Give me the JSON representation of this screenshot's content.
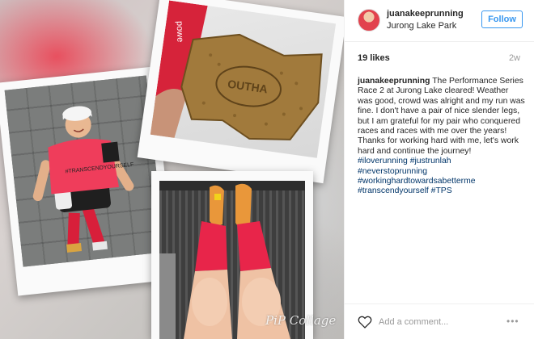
{
  "post": {
    "author": {
      "username": "juanakeeprunning",
      "location": "Jurong Lake Park"
    },
    "follow_label": "Follow",
    "likes": "19 likes",
    "time_ago": "2w",
    "caption_user": "juanakeeprunning",
    "caption_text": "The Performance Series Race 2 at Jurong Lake cleared! Weather was good, crowd was alright and my run was fine. I don't have a pair of nice slender legs, but I am grateful for my pair who conquered races and races with me over the years! Thanks for working hard with me, let's work hard and continue the journey!",
    "hashtags": [
      "#iloverunning #justrunlah",
      "#neverstoprunning",
      "#workinghardtowardsabetterme",
      "#transcendyourself #TPS"
    ],
    "comment_placeholder": "Add a comment...",
    "more_label": "•••"
  },
  "collage": {
    "watermark": "PiP Collage",
    "medal_text": "OUTHA"
  },
  "colors": {
    "accent": "#3897f0",
    "hashtag": "#003569",
    "muted": "#999999"
  }
}
